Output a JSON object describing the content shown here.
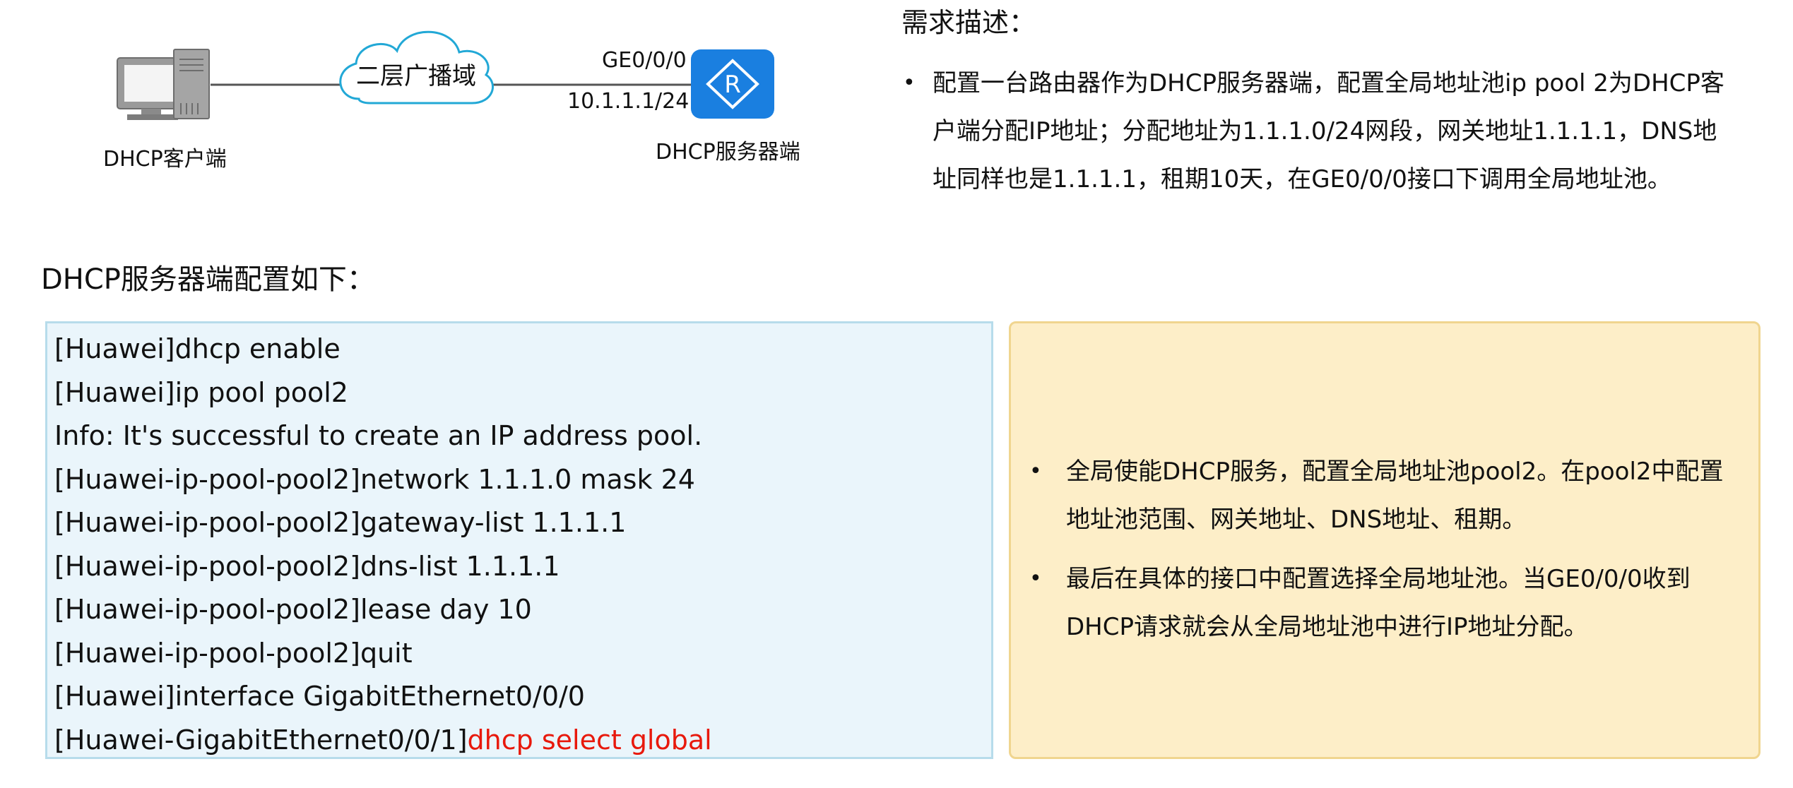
{
  "diagram": {
    "client_label": "DHCP客户端",
    "cloud_label": "二层广播域",
    "interface_label": "GE0/0/0",
    "ip_label": "10.1.1.1/24",
    "server_label": "DHCP服务器端",
    "router_letter": "R",
    "router_color": "#1a7fe0"
  },
  "requirements": {
    "title": "需求描述：",
    "bullet": "•",
    "items": [
      "配置一台路由器作为DHCP服务器端，配置全局地址池ip pool 2为DHCP客户端分配IP地址；分配地址为1.1.1.0/24网段，网关地址1.1.1.1，DNS地址同样也是1.1.1.1，租期10天，在GE0/0/0接口下调用全局地址池。"
    ]
  },
  "section_title": "DHCP服务器端配置如下：",
  "config": {
    "lines": [
      "[Huawei]dhcp enable",
      "[Huawei]ip pool pool2",
      "Info: It's successful to create an IP address pool.",
      "[Huawei-ip-pool-pool2]network 1.1.1.0 mask 24",
      "[Huawei-ip-pool-pool2]gateway-list 1.1.1.1",
      "[Huawei-ip-pool-pool2]dns-list 1.1.1.1",
      "[Huawei-ip-pool-pool2]lease day 10",
      "[Huawei-ip-pool-pool2]quit",
      "[Huawei]interface GigabitEthernet0/0/0"
    ],
    "last_line_prefix": "[Huawei-GigabitEthernet0/0/1]",
    "last_line_highlight": "dhcp select global",
    "highlight_color": "#e8190c"
  },
  "notes": {
    "bullet": "•",
    "items": [
      "全局使能DHCP服务，配置全局地址池pool2。在pool2中配置地址池范围、网关地址、DNS地址、租期。",
      "最后在具体的接口中配置选择全局地址池。当GE0/0/0收到DHCP请求就会从全局地址池中进行IP地址分配。"
    ]
  }
}
